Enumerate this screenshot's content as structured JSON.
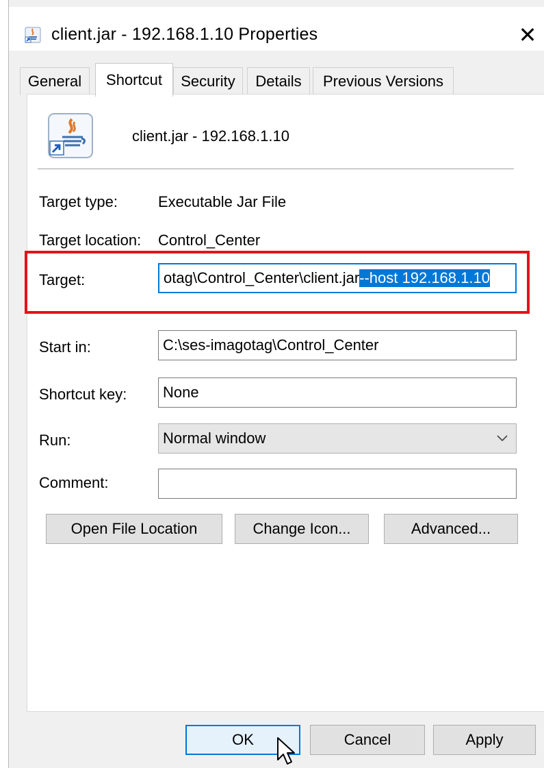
{
  "window": {
    "title": "client.jar - 192.168.1.10 Properties",
    "close_symbol": "✕"
  },
  "tabs": [
    {
      "label": "General"
    },
    {
      "label": "Shortcut",
      "active": true
    },
    {
      "label": "Security"
    },
    {
      "label": "Details"
    },
    {
      "label": "Previous Versions"
    }
  ],
  "shortcut": {
    "name": "client.jar - 192.168.1.10",
    "icon": "java-jar-shortcut-icon",
    "target_type_label": "Target type:",
    "target_type_value": "Executable Jar File",
    "target_location_label": "Target location:",
    "target_location_value": "Control_Center",
    "target_label": "Target:",
    "target_value_unselected": "otag\\Control_Center\\client.jar ",
    "target_value_selected": "--host 192.168.1.10",
    "start_in_label": "Start in:",
    "start_in_value": "C:\\ses-imagotag\\Control_Center",
    "shortcut_key_label": "Shortcut key:",
    "shortcut_key_value": "None",
    "run_label": "Run:",
    "run_value": "Normal window",
    "comment_label": "Comment:",
    "comment_value": ""
  },
  "actions": {
    "open_file_location": "Open File Location",
    "change_icon": "Change Icon...",
    "advanced": "Advanced..."
  },
  "footer": {
    "ok": "OK",
    "cancel": "Cancel",
    "apply": "Apply"
  },
  "colors": {
    "highlight": "#0078d7",
    "annotation_red": "#e5121c",
    "window_bg": "#f0f0f0"
  }
}
